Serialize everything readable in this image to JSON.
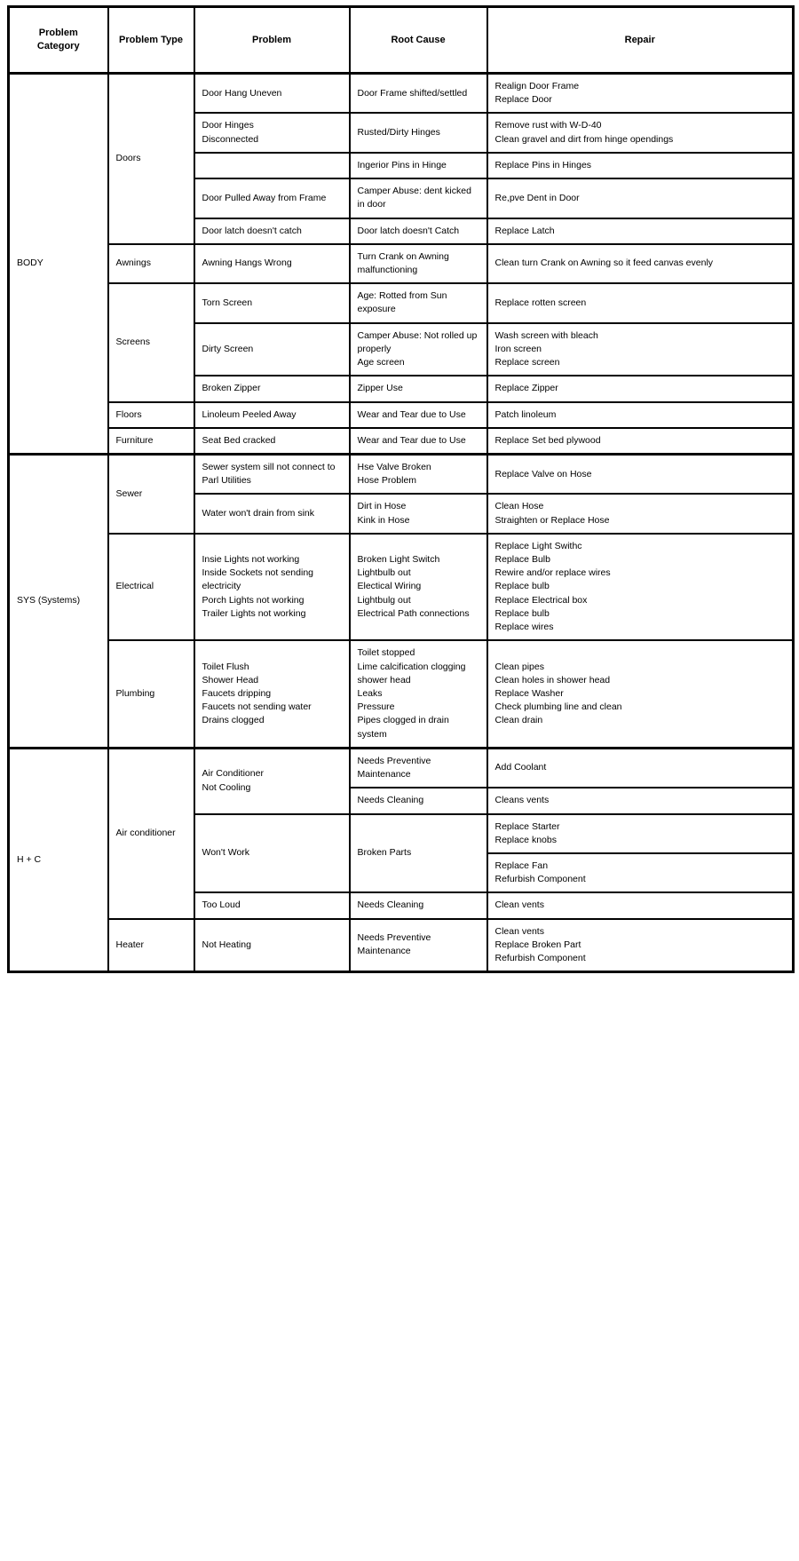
{
  "table": {
    "columns": [
      {
        "key": "category",
        "label": "Problem\nCategory"
      },
      {
        "key": "type",
        "label": "Problem Type"
      },
      {
        "key": "problem",
        "label": "Problem"
      },
      {
        "key": "root_cause",
        "label": "Root Cause"
      },
      {
        "key": "repair",
        "label": "Repair"
      }
    ],
    "categories": [
      {
        "name": "BODY",
        "types": [
          {
            "name": "Doors",
            "rows": [
              {
                "problem": "Door Hang Uneven",
                "root_cause": "Door Frame shifted/settled",
                "repair": "Realign Door Frame\nReplace Door"
              },
              {
                "problem": "Door Hinges\nDisconnected",
                "root_cause": "Rusted/Dirty Hinges",
                "repair": "Remove rust with W-D-40\nClean gravel and dirt from hinge opendings"
              },
              {
                "problem": "",
                "root_cause": "Ingerior Pins in Hinge",
                "repair": "Replace Pins in Hinges"
              },
              {
                "problem": "Door Pulled Away from Frame",
                "root_cause": "Camper Abuse: dent kicked in door",
                "repair": "Re,pve Dent in Door"
              },
              {
                "problem": "Door latch doesn't catch",
                "root_cause": "Door latch doesn't Catch",
                "repair": "Replace Latch"
              }
            ]
          },
          {
            "name": "Awnings",
            "rows": [
              {
                "problem": "Awning Hangs Wrong",
                "root_cause": "Turn Crank on Awning malfunctioning",
                "repair": "Clean turn Crank on Awning so it feed canvas evenly"
              }
            ]
          },
          {
            "name": "Screens",
            "rows": [
              {
                "problem": "Torn Screen",
                "root_cause": "Age: Rotted from Sun exposure",
                "repair": "Replace rotten screen"
              },
              {
                "problem": "Dirty Screen",
                "root_cause": "Camper Abuse: Not rolled up properly\nAge screen",
                "repair": "Wash screen with bleach\nIron screen\nReplace screen"
              },
              {
                "problem": "Broken Zipper",
                "root_cause": "Zipper Use",
                "repair": "Replace Zipper"
              }
            ]
          },
          {
            "name": "Floors",
            "rows": [
              {
                "problem": "Linoleum Peeled Away",
                "root_cause": "Wear and Tear due to Use",
                "repair": "Patch linoleum"
              }
            ]
          },
          {
            "name": "Furniture",
            "rows": [
              {
                "problem": "Seat Bed cracked",
                "root_cause": "Wear and Tear due to Use",
                "repair": "Replace Set bed plywood"
              }
            ]
          }
        ]
      },
      {
        "name": "SYS (Systems)",
        "types": [
          {
            "name": "Sewer",
            "rows": [
              {
                "problem": "Sewer system sill not connect to Parl Utilities",
                "root_cause": "Hse Valve Broken\nHose Problem",
                "repair": "Replace Valve on Hose"
              },
              {
                "problem": "Water won't drain from sink",
                "root_cause": "Dirt in Hose\nKink in Hose",
                "repair": "Clean Hose\nStraighten or Replace Hose"
              }
            ]
          },
          {
            "name": "Electrical",
            "rows": [
              {
                "problem": "Insie Lights not working\nInside Sockets not sending electricity\nPorch Lights not working\nTrailer Lights not working",
                "root_cause": "Broken Light Switch\nLightbulb out\nElectical Wiring\nLightbulg out\nElectrical Path connections",
                "repair": "Replace Light Swithc\nReplace Bulb\nRewire and/or replace wires\nReplace bulb\nReplace Electrical box\nReplace bulb\nReplace wires"
              }
            ]
          },
          {
            "name": "Plumbing",
            "rows": [
              {
                "problem": "Toilet Flush\nShower Head\nFaucets dripping\nFaucets not sending water\nDrains clogged",
                "root_cause": "Toilet stopped\nLime calcification clogging shower head\nLeaks\nPressure\nPipes clogged in drain system",
                "repair": "Clean pipes\nClean holes in shower head\nReplace Washer\nCheck plumbing line and clean\nClean drain"
              }
            ]
          }
        ]
      },
      {
        "name": "H + C",
        "types": [
          {
            "name": "Air conditioner",
            "rows": [
              {
                "problem": "Air Conditioner\nNot Cooling",
                "problem_rowspan": 2,
                "root_cause": "Needs Preventive Maintenance",
                "repair": "Add Coolant"
              },
              {
                "problem": null,
                "root_cause": "Needs Cleaning",
                "repair": "Cleans vents"
              },
              {
                "problem": "Won't Work",
                "problem_rowspan": 2,
                "root_cause": "Broken Parts",
                "root_cause_rowspan": 2,
                "repair": "Replace Starter\nReplace knobs"
              },
              {
                "problem": null,
                "root_cause": null,
                "repair": "Replace Fan\nRefurbish Component"
              },
              {
                "problem": "Too Loud",
                "root_cause": "Needs Cleaning",
                "repair": "Clean vents"
              }
            ]
          },
          {
            "name": "Heater",
            "rows": [
              {
                "problem": "Not Heating",
                "root_cause": "Needs Preventive Maintenance",
                "repair": "Clean vents\nReplace Broken Part\nRefurbish Component"
              }
            ]
          }
        ]
      }
    ]
  }
}
